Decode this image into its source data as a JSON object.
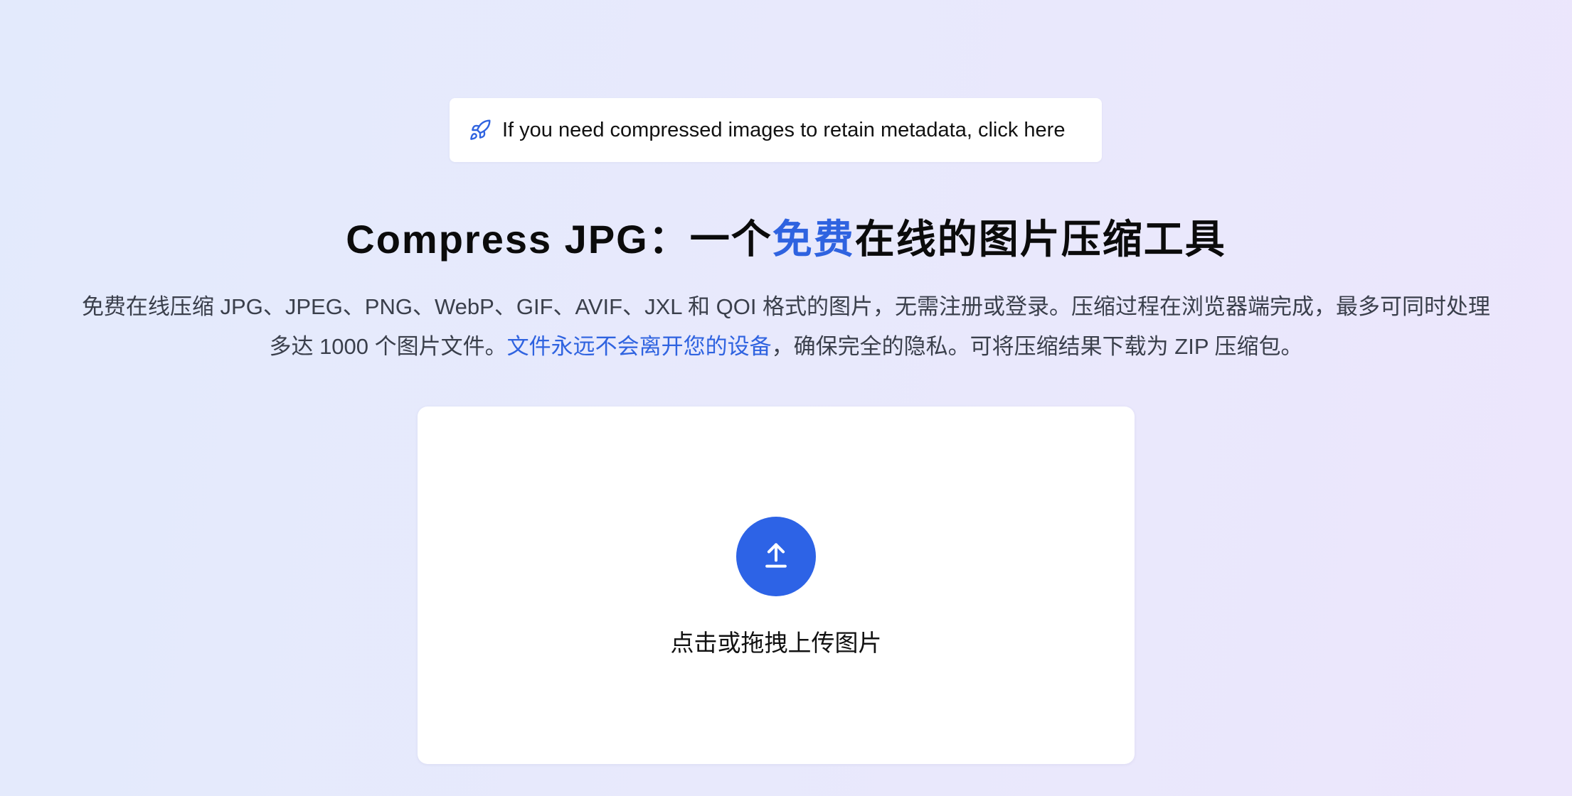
{
  "colors": {
    "accent": "#2f63e0",
    "upload_button": "#2d63e6",
    "card_background": "#ffffff"
  },
  "banner": {
    "icon": "rocket-icon",
    "text": "If you need compressed images to retain metadata, click here"
  },
  "headline": {
    "prefix": "Compress JPG：一个",
    "accent": "免费",
    "suffix": "在线的图片压缩工具"
  },
  "description": {
    "line1": "免费在线压缩 JPG、JPEG、PNG、WebP、GIF、AVIF、JXL 和 QOI 格式的图片，无需注册或登录。压缩过程在浏览器端完成，最多可同时处理",
    "line2_prefix": "多达 1000 个图片文件。",
    "line2_link": "文件永远不会离开您的设备",
    "line2_suffix": "，确保完全的隐私。可将压缩结果下载为 ZIP 压缩包。"
  },
  "upload": {
    "icon": "upload-icon",
    "label": "点击或拖拽上传图片"
  }
}
